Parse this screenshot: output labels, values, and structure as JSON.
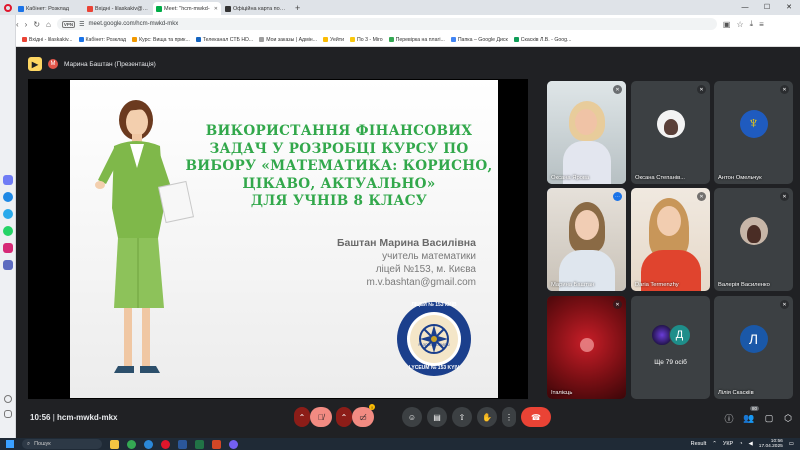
{
  "browser": {
    "tabs": [
      {
        "label": "Кабінет: Розклад",
        "color": "#1a73e8",
        "active": false
      },
      {
        "label": "Вхідні - lilaskakiv@gmail",
        "color": "#ea4335",
        "active": false
      },
      {
        "label": "Meet: \"hcm-mwkd-",
        "color": "#00ac47",
        "active": true
      },
      {
        "label": "Офіційна карта повітрян",
        "color": "#333333",
        "active": false
      }
    ],
    "new_tab": "+",
    "window_controls": [
      "—",
      "☐",
      "✕"
    ],
    "url": "meet.google.com/hcm-mwkd-mkx",
    "vpn_label": "VPN",
    "bookmarks": [
      {
        "label": "Вхідні - lilaskakiv...",
        "color": "#ea4335"
      },
      {
        "label": "Кабінет: Розклад",
        "color": "#1a73e8"
      },
      {
        "label": "Курс: Вища та прик...",
        "color": "#f29900"
      },
      {
        "label": "Телеканал СТБ HD...",
        "color": "#1565c0"
      },
      {
        "label": "Мои заказы | Адмін...",
        "color": "#9e9e9e"
      },
      {
        "label": "Уейти",
        "color": "#fbbc04"
      },
      {
        "label": "По 3 - Miro",
        "color": "#f9c80e"
      },
      {
        "label": "Перевірка на плагі...",
        "color": "#34a853"
      },
      {
        "label": "Папка – Google Диск",
        "color": "#4285f4"
      },
      {
        "label": "Скасків Л.В. - Goog...",
        "color": "#0f9d58"
      }
    ]
  },
  "meet": {
    "presenter_avatar_letter": "М",
    "presenter_label": "Марина Баштан (Презентація)",
    "meeting_time": "10:56",
    "meeting_code": "hcm-mwkd-mkx",
    "participants_badge": "80",
    "slide": {
      "title_lines": [
        "ВИКОРИСТАННЯ ФІНАНСОВИХ",
        "ЗАДАЧ У РОЗРОБЦІ КУРСУ ПО",
        "ВИБОРУ «МАТЕМАТИКА: КОРИСНО,",
        "ЦІКАВО, АКТУАЛЬНО»",
        "ДЛЯ УЧНІВ 8 КЛАСУ"
      ],
      "author": "Баштан Марина Василівна",
      "position": "учитель математики",
      "school": "ліцей №153, м. Києва",
      "email": "m.v.bashtan@gmail.com",
      "logo_top_text": "ЛІЦЕЙ № 153 КИЇВ",
      "logo_bottom_text": "LYCEUM № 153 KYIV",
      "logo_center_text": "РАЗОМ МИ–СИЛА!"
    },
    "participants": [
      {
        "name": "Оксана Ярова",
        "kind": "video",
        "bg": "#b9c2c7",
        "muted": true
      },
      {
        "name": "Оксана Степанів...",
        "kind": "photo",
        "bg": "#3c4043",
        "muted": true
      },
      {
        "name": "Антон Омельчук",
        "kind": "emblem",
        "bg": "#3c4043",
        "muted": true
      },
      {
        "name": "Марина Баштан",
        "kind": "video",
        "bg": "#cfc8bf",
        "muted": false,
        "speaking": true
      },
      {
        "name": "Daria Termenzhy",
        "kind": "video",
        "bg": "#d9503f",
        "muted": true
      },
      {
        "name": "Валерія Василенко",
        "kind": "photo",
        "bg": "#3c4043",
        "muted": true
      },
      {
        "name": "Італієць",
        "kind": "video",
        "bg": "#7a0f14",
        "muted": true
      },
      {
        "name": "Ще 79 осіб",
        "kind": "more",
        "bg": "#3c4043",
        "letters": [
          "",
          "Д"
        ]
      },
      {
        "name": "Лілія Скаскіів",
        "kind": "letter",
        "bg": "#3c4043",
        "letter": "Л",
        "muted": true
      }
    ]
  },
  "taskbar": {
    "search_placeholder": "Пошук",
    "weather": "Result",
    "language": "УКР",
    "time": "10:56",
    "date": "17.04.2025"
  }
}
